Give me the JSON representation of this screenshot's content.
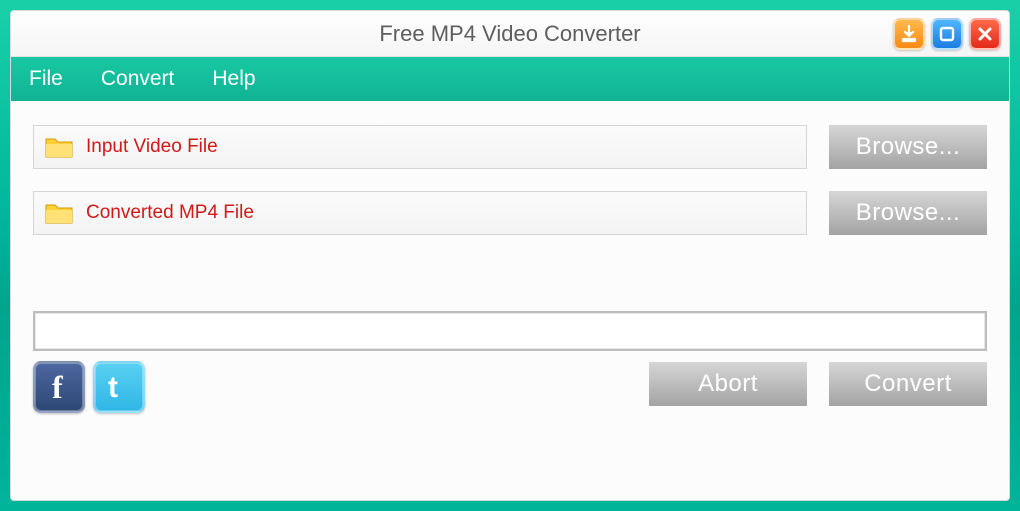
{
  "titlebar": {
    "title": "Free MP4 Video Converter"
  },
  "menubar": {
    "file": "File",
    "convert": "Convert",
    "help": "Help"
  },
  "input_row": {
    "label": "Input Video File",
    "browse": "Browse..."
  },
  "output_row": {
    "label": "Converted MP4 File",
    "browse": "Browse..."
  },
  "actions": {
    "abort": "Abort",
    "convert": "Convert"
  },
  "icons": {
    "download": "download-icon",
    "maximize": "maximize-icon",
    "close": "close-icon",
    "folder": "folder-icon",
    "facebook": "facebook-icon",
    "twitter": "twitter-icon"
  }
}
